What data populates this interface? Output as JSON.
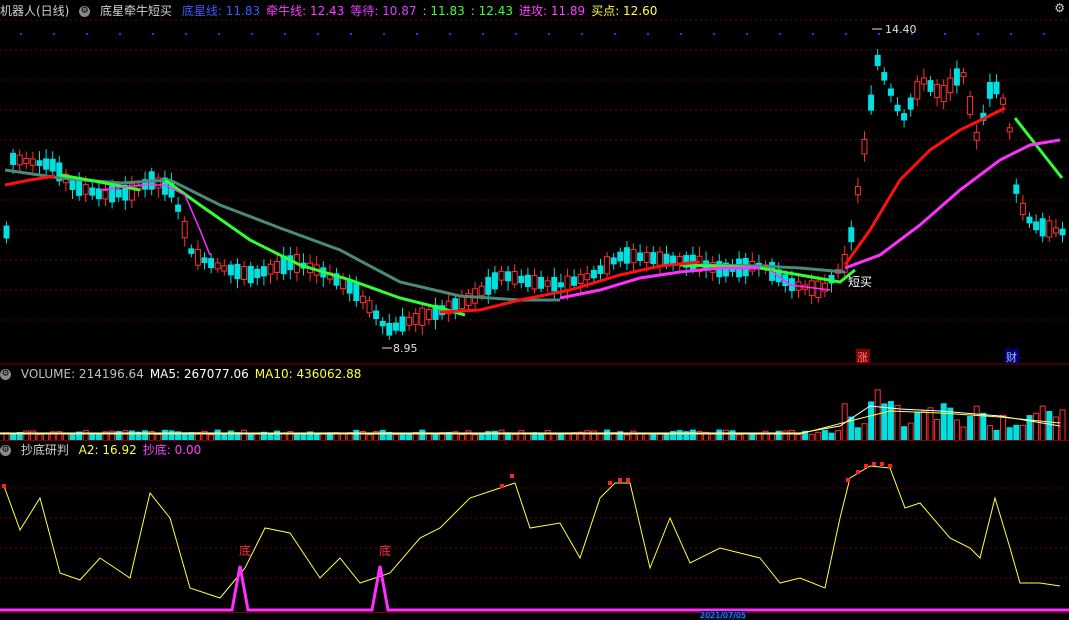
{
  "header1": {
    "indicator": "机器人(日线)",
    "formula": "底星牵牛短买",
    "items": [
      {
        "label": "底星线: 11.83",
        "color": "#3b5bff"
      },
      {
        "label": "牵牛线: 12.43",
        "color": "#ff3bff"
      },
      {
        "label": "等待: 10.87",
        "color": "#e040ff"
      },
      {
        "label": ": 11.83",
        "color": "#40ff40"
      },
      {
        "label": ": 12.43",
        "color": "#40ff40"
      },
      {
        "label": "进攻: 11.89",
        "color": "#ff40ff"
      },
      {
        "label": "买点: 12.60",
        "color": "#ffff40"
      }
    ]
  },
  "main_chart": {
    "high_label": "14.40",
    "low_label": "8.95",
    "signal_label": "短买",
    "badge_zhang": "涨",
    "badge_cai": "财"
  },
  "header2": {
    "items": [
      {
        "label": "VOLUME: 214196.64",
        "color": "#c0c0c0"
      },
      {
        "label": "MA5: 267077.06",
        "color": "#ffffff"
      },
      {
        "label": "MA10: 436062.88",
        "color": "#ffff40"
      }
    ]
  },
  "header3": {
    "title": "抄底研判",
    "items": [
      {
        "label": "A2: 16.92",
        "color": "#ffff40"
      },
      {
        "label": "抄底: 0.00",
        "color": "#ff40ff"
      }
    ]
  },
  "sub_chart": {
    "bottom_marker_1": "底",
    "bottom_marker_2": "底"
  },
  "bottom_bar": {
    "date": "2021/07/05"
  },
  "colors": {
    "up": "#ff3030",
    "down": "#00e0e0",
    "red_line": "#ff1010",
    "magenta_line": "#ff30ff",
    "green_line": "#30ff30",
    "gray_line": "#4a8a7a",
    "yellow_line": "#ffff40"
  }
}
